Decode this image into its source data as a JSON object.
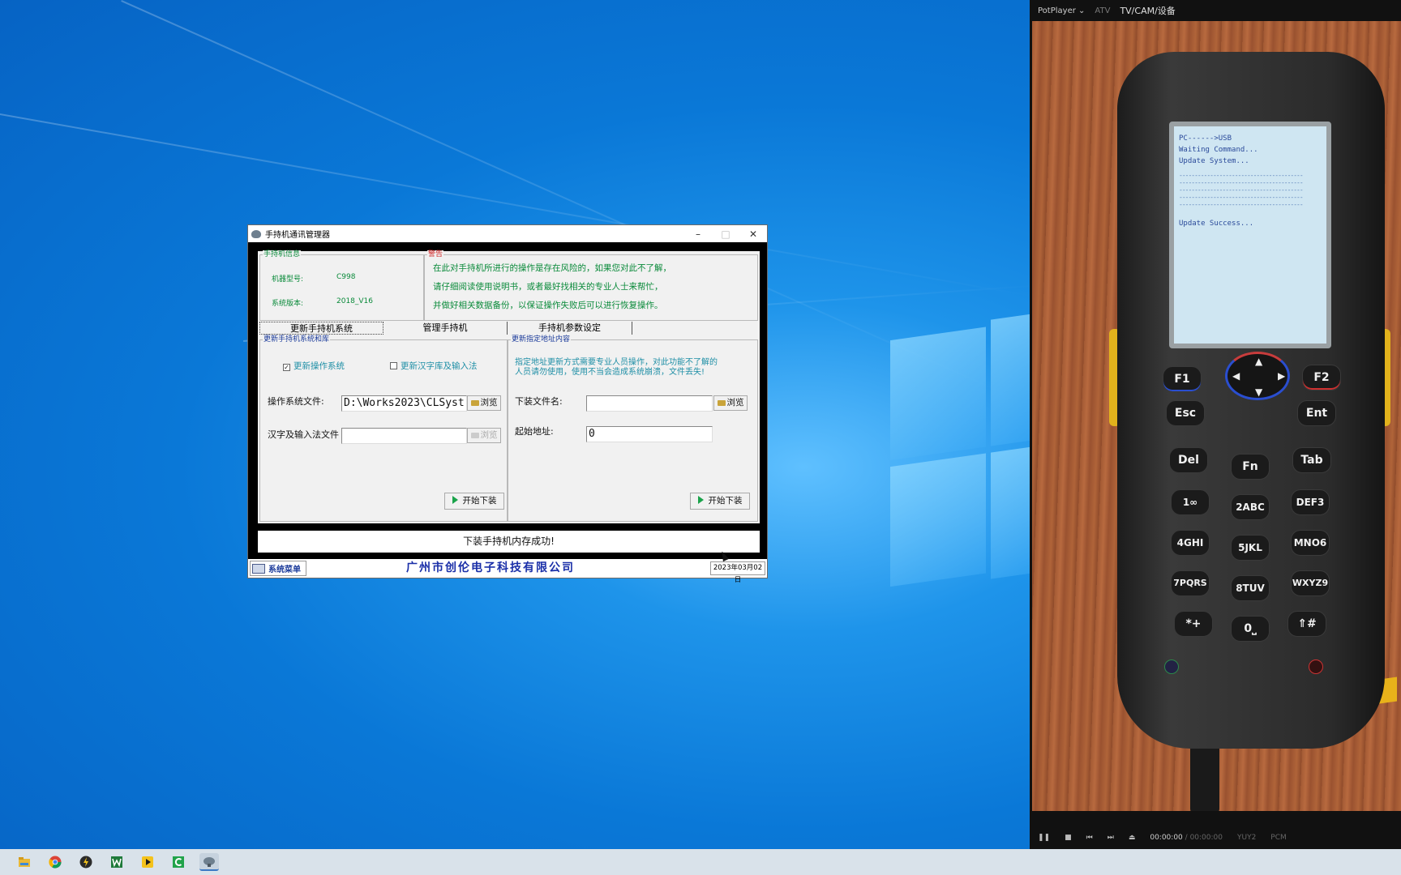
{
  "window": {
    "title": "手持机通讯管理器",
    "minimize": "–",
    "maximize": "□",
    "close": "✕"
  },
  "device_info": {
    "legend": "手持机信息",
    "model_label": "机器型号:",
    "model_value": "C998",
    "version_label": "系统版本:",
    "version_value": "2018_V16"
  },
  "warning": {
    "legend": "警告",
    "lines": [
      "在此对手持机所进行的操作是存在风险的，如果您对此不了解，",
      "请仔细阅读使用说明书，或者最好找相关的专业人士来帮忙，",
      "并做好相关数据备份，以保证操作失败后可以进行恢复操作。"
    ]
  },
  "tabs": [
    {
      "label": "更新手持机系统",
      "active": true
    },
    {
      "label": "管理手持机",
      "active": false
    },
    {
      "label": "手持机参数设定",
      "active": false
    }
  ],
  "left_panel": {
    "legend": "更新手持机系统和库",
    "opt_os": {
      "label": "更新操作系统",
      "checked": true
    },
    "opt_font": {
      "label": "更新汉字库及输入法",
      "checked": false
    },
    "os_file_label": "操作系统文件:",
    "os_file_value": "D:\\Works2023\\CLSyst",
    "font_file_label": "汉字及输入法文件",
    "font_file_value": "",
    "browse": "浏览",
    "start": "开始下装"
  },
  "right_panel": {
    "legend": "更新指定地址内容",
    "note": [
      "指定地址更新方式需要专业人员操作，对此功能不了解的",
      "人员请勿使用，使用不当会造成系统崩溃，文件丢失!"
    ],
    "download_file_label": "下装文件名:",
    "download_file_value": "",
    "start_addr_label": "起始地址:",
    "start_addr_value": "0",
    "browse": "浏览",
    "start": "开始下装"
  },
  "status_message": "下装手持机内存成功!",
  "bottom": {
    "menu": "系统菜单",
    "company": "广州市创伦电子科技有限公司",
    "date": "2023年03月02日"
  },
  "potplayer": {
    "app": "PotPlayer",
    "chevron": "⌄",
    "mode": "ATV",
    "source": "TV/CAM/设备",
    "time_current": "00:00:00",
    "time_sep": "/",
    "time_total": "00:00:00",
    "video_fmt": "YUY2",
    "audio_fmt": "PCM"
  },
  "device_screen": {
    "lines": [
      "PC------>USB",
      "Waiting Command...",
      "Update System..."
    ],
    "success": "Update Success..."
  },
  "keypad": {
    "f1": "F1",
    "f2": "F2",
    "esc": "Esc",
    "ent": "Ent",
    "del": "Del",
    "fn": "Fn",
    "tab": "Tab",
    "k1": "1∞",
    "k2": "2ABC",
    "k3": "DEF3",
    "k4": "4GHI",
    "k5": "5JKL",
    "k6": "MNO6",
    "k7": "7PQRS",
    "k8": "8TUV",
    "k9": "WXYZ9",
    "kstar": "*+",
    "k0": "0⎵",
    "khash": "⇑#"
  },
  "colors": {
    "desktop": "#0a78d7",
    "accent_green": "#0a8a3a",
    "company_blue": "#1a2fa8"
  }
}
